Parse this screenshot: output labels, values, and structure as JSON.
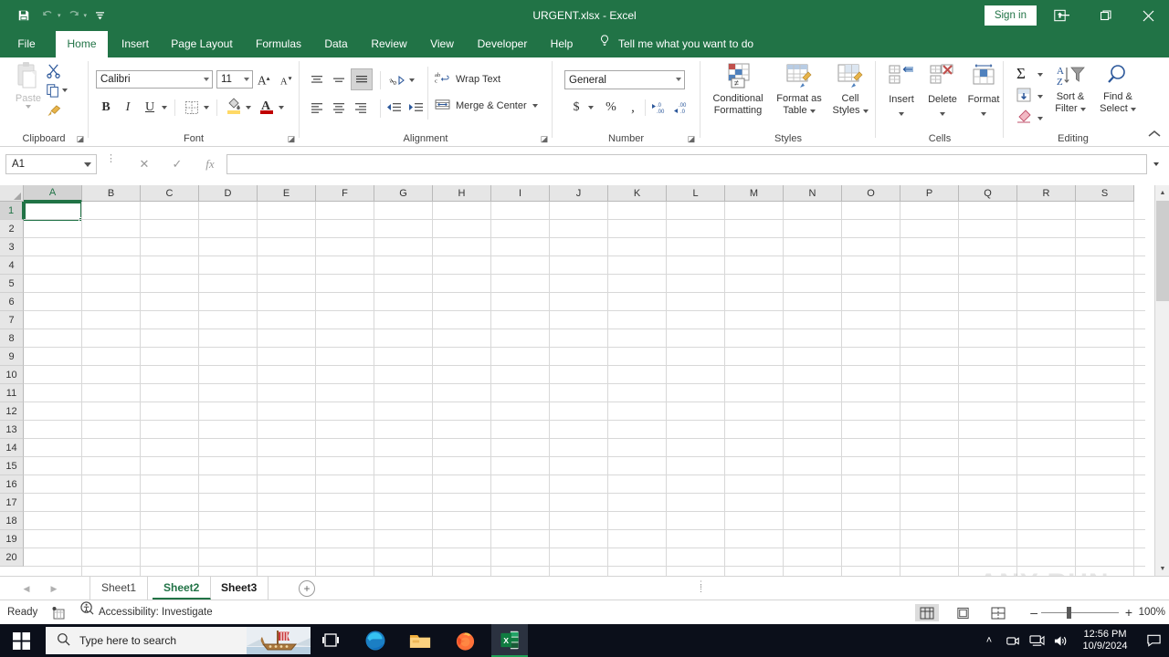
{
  "titlebar": {
    "document_title": "URGENT.xlsx  -  Excel",
    "sign_in_label": "Sign in",
    "quick_access": [
      {
        "name": "save",
        "icon": "save-icon"
      },
      {
        "name": "undo",
        "icon": "undo-icon"
      },
      {
        "name": "redo",
        "icon": "redo-icon"
      },
      {
        "name": "customize",
        "icon": "chevron-down-icon"
      }
    ],
    "window_buttons": {
      "minimize": "–",
      "maximize": "❐",
      "close": "✕"
    },
    "ribbon_display_options": "ribbon-display-options-icon"
  },
  "ribbon_tabs": [
    {
      "label": "File",
      "active": false
    },
    {
      "label": "Home",
      "active": true
    },
    {
      "label": "Insert",
      "active": false
    },
    {
      "label": "Page Layout",
      "active": false
    },
    {
      "label": "Formulas",
      "active": false
    },
    {
      "label": "Data",
      "active": false
    },
    {
      "label": "Review",
      "active": false
    },
    {
      "label": "View",
      "active": false
    },
    {
      "label": "Developer",
      "active": false
    },
    {
      "label": "Help",
      "active": false
    }
  ],
  "tell_me": {
    "label": "Tell me what you want to do",
    "icon": "lightbulb-icon"
  },
  "ribbon": {
    "clipboard": {
      "group_label": "Clipboard",
      "paste_label": "Paste",
      "cut_label": "Cut",
      "copy_label": "Copy",
      "format_painter_label": "Format Painter"
    },
    "font": {
      "group_label": "Font",
      "font_family_value": "Calibri",
      "font_size_value": "11",
      "grow_font": "A",
      "shrink_font": "A",
      "bold": "B",
      "italic": "I",
      "underline": "U",
      "borders_label": "Borders",
      "fill_color_label": "Fill Color",
      "font_color_label": "Font Color"
    },
    "alignment": {
      "group_label": "Alignment",
      "wrap_text_label": "Wrap Text",
      "merge_center_label": "Merge & Center",
      "orientation_label": "Orientation",
      "decrease_indent_label": "Decrease Indent",
      "increase_indent_label": "Increase Indent"
    },
    "number": {
      "group_label": "Number",
      "format_value": "General",
      "accounting_label": "$",
      "percent_label": "%",
      "comma_label": ",",
      "increase_decimal_label": ".00",
      "decrease_decimal_label": ".00"
    },
    "styles": {
      "group_label": "Styles",
      "conditional_formatting_line1": "Conditional",
      "conditional_formatting_line2": "Formatting",
      "format_as_table_line1": "Format as",
      "format_as_table_line2": "Table",
      "cell_styles_line1": "Cell",
      "cell_styles_line2": "Styles"
    },
    "cells": {
      "group_label": "Cells",
      "insert_label": "Insert",
      "delete_label": "Delete",
      "format_label": "Format"
    },
    "editing": {
      "group_label": "Editing",
      "autosum_label": "AutoSum",
      "fill_label": "Fill",
      "clear_label": "Clear",
      "sort_filter_line1": "Sort &",
      "sort_filter_line2": "Filter",
      "find_select_line1": "Find &",
      "find_select_line2": "Select"
    },
    "collapse_label": "collapse-ribbon-icon"
  },
  "formula_bar": {
    "name_box_value": "A1",
    "cancel_icon": "✕",
    "enter_icon": "✓",
    "insert_function_icon": "fx",
    "formula_value": "",
    "expand_icon": "˅"
  },
  "sheet": {
    "columns": [
      "A",
      "B",
      "C",
      "D",
      "E",
      "F",
      "G",
      "H",
      "I",
      "J",
      "K",
      "L",
      "M",
      "N",
      "O",
      "P",
      "Q",
      "R",
      "S"
    ],
    "rows": [
      1,
      2,
      3,
      4,
      5,
      6,
      7,
      8,
      9,
      10,
      11,
      12,
      13,
      14,
      15,
      16,
      17,
      18,
      19,
      20
    ],
    "selected_cell": "A1",
    "selected_column": "A",
    "selected_row": 1,
    "cell_values": []
  },
  "sheet_tabs": {
    "tabs": [
      {
        "label": "Sheet1",
        "active": false,
        "bold": false
      },
      {
        "label": "Sheet2",
        "active": true,
        "bold": true
      },
      {
        "label": "Sheet3",
        "active": false,
        "bold": true
      }
    ],
    "add_sheet_label": "+",
    "prev_label": "◀",
    "next_label": "▶"
  },
  "status_bar": {
    "status_text": "Ready",
    "macro_record_icon": "macro-record-icon",
    "accessibility_text": "Accessibility: Investigate",
    "view_normal": "normal-view-icon",
    "view_page_layout": "page-layout-view-icon",
    "view_page_break": "page-break-preview-icon",
    "zoom_out": "–",
    "zoom_in": "+",
    "zoom_level": "100%"
  },
  "taskbar": {
    "search_placeholder": "Type here to search",
    "start_icon": "windows-start-icon",
    "items": [
      {
        "name": "task-view",
        "icon": "task-view-icon"
      },
      {
        "name": "microsoft-edge",
        "icon": "edge-icon"
      },
      {
        "name": "file-explorer",
        "icon": "folder-icon"
      },
      {
        "name": "firefox",
        "icon": "firefox-icon"
      },
      {
        "name": "excel",
        "icon": "excel-icon",
        "active": true
      }
    ],
    "tray": {
      "show_hidden_icons": "˄",
      "camera_icon": "camera-icon",
      "network_icon": "network-icon",
      "volume_icon": "volume-icon",
      "time": "12:56 PM",
      "date": "10/9/2024",
      "notification_icon": "notification-icon"
    }
  },
  "watermark": {
    "text": "ANY RUN"
  },
  "colors": {
    "excel_green": "#217346",
    "ribbon_bg": "#ffffff",
    "header_gray": "#e6e6e6",
    "taskbar": "#0b0f1a"
  }
}
